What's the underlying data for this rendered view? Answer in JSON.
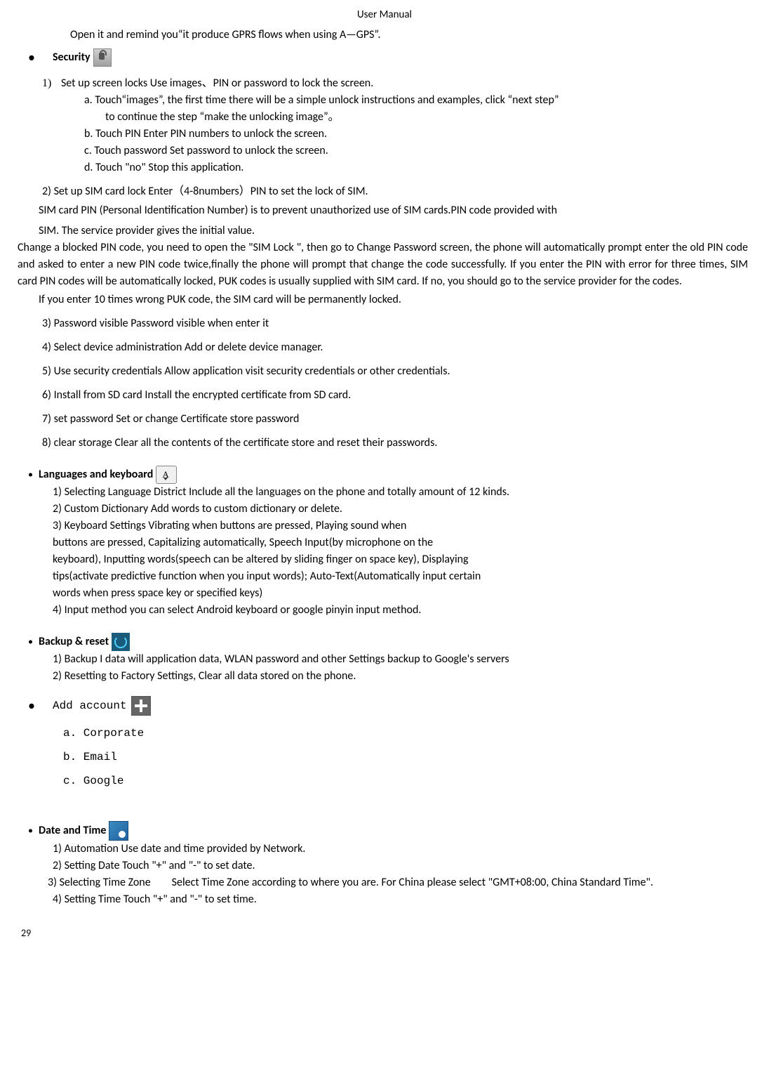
{
  "header": "User    Manual",
  "opening": "Open it and remind you“it produce GPRS flows when using A—GPS”.",
  "security": {
    "title": "Security",
    "item1": {
      "num": "1)",
      "text": "Set up screen locks      Use images、PIN or password to lock the screen."
    },
    "sub_a": "a. Touch“images”,    the first time there will be a simple unlock instructions and examples, click “next step”",
    "sub_a_cont": "to continue the step “make the unlocking image”。",
    "sub_b": "b. Touch PIN Enter PIN numbers to unlock the screen.",
    "sub_c": "c. Touch password      Set password to unlock the screen.",
    "sub_d": "d. Touch \"no\"      Stop this application.",
    "item2": "2)    Set up SIM card lock      Enter（4-8numbers）PIN to set the lock of SIM.",
    "pin_para1": "SIM card PIN (Personal Identification Number) is to prevent unauthorized use of SIM cards.PIN code provided with",
    "pin_para2": "SIM. The service provider gives the initial value.",
    "change_pin": "Change  a  blocked  PIN  code,  you  need  to  open  the  \"SIM  Lock  \",  then  go  to  Change  Password  screen,  the  phone  will automatically prompt enter the old PIN code and asked to enter a new PIN code twice,finally the phone will prompt that change the  code successfully.  If you  enter the  PIN with error for  three times,  SIM  card PIN  codes will be  automatically locked, PUK codes is usually supplied with SIM card. If no, you should go to the service provider for the codes.",
    "puk_warning": "If you enter 10 times wrong PUK code, the SIM card will be permanently locked.",
    "item3": "3)    Password visible        Password visible when enter it",
    "item4": "4)    Select device administration      Add or delete device manager.",
    "item5": "5)    Use security credentials        Allow application visit security credentials or other credentials.",
    "item6": "6)    Install from SD card      Install the encrypted certificate from SD card.",
    "item7": "7)    set password        Set or change Certificate store password",
    "item8": "8)    clear storage        Clear all the contents of the certificate store and reset their passwords."
  },
  "languages": {
    "title": "Languages and keyboard",
    "item1": "1) Selecting Language District        Include all the languages on the phone and totally amount of 12 kinds.",
    "item2": "2) Custom Dictionary          Add words to custom dictionary or delete.",
    "item3_l1": "3) Keyboard Settings        Vibrating when buttons are pressed, Playing sound when",
    "item3_l2": "buttons are pressed, Capitalizing automatically, Speech Input(by microphone on the",
    "item3_l3": "keyboard), Inputting words(speech can be altered by sliding finger on space key), Displaying",
    "item3_l4": "tips(activate predictive function when you input words); Auto-Text(Automatically input certain",
    "item3_l5": "words when press space key or specified keys)",
    "item4": "4) Input method        you can select Android keyboard or google pinyin input method."
  },
  "backup": {
    "title": "Backup & reset",
    "item1": "1)    Backup I data will application data, WLAN password and other Settings backup to Google's servers",
    "item2": "2)    Resetting to Factory Settings, Clear all data stored on the phone."
  },
  "add_account": {
    "title": "Add account",
    "opt_a": "a.  Corporate",
    "opt_b": "b.  Email",
    "opt_c": "c.  Google"
  },
  "datetime": {
    "title": "Date and Time",
    "item1": "1) Automation        Use date and time provided by Network.",
    "item2": "2) Setting Date        Touch \"+\" and \"-\" to set date.",
    "item3_label": "3) Selecting  Time  Zone",
    "item3_text": "Select  Time  Zone according  to where  you  are.  For  China  please  select  \"GMT+08:00, China Standard Time\".",
    "item4": "4) Setting Time        Touch \"+\" and \"-\" to set time."
  },
  "page_number": "29"
}
